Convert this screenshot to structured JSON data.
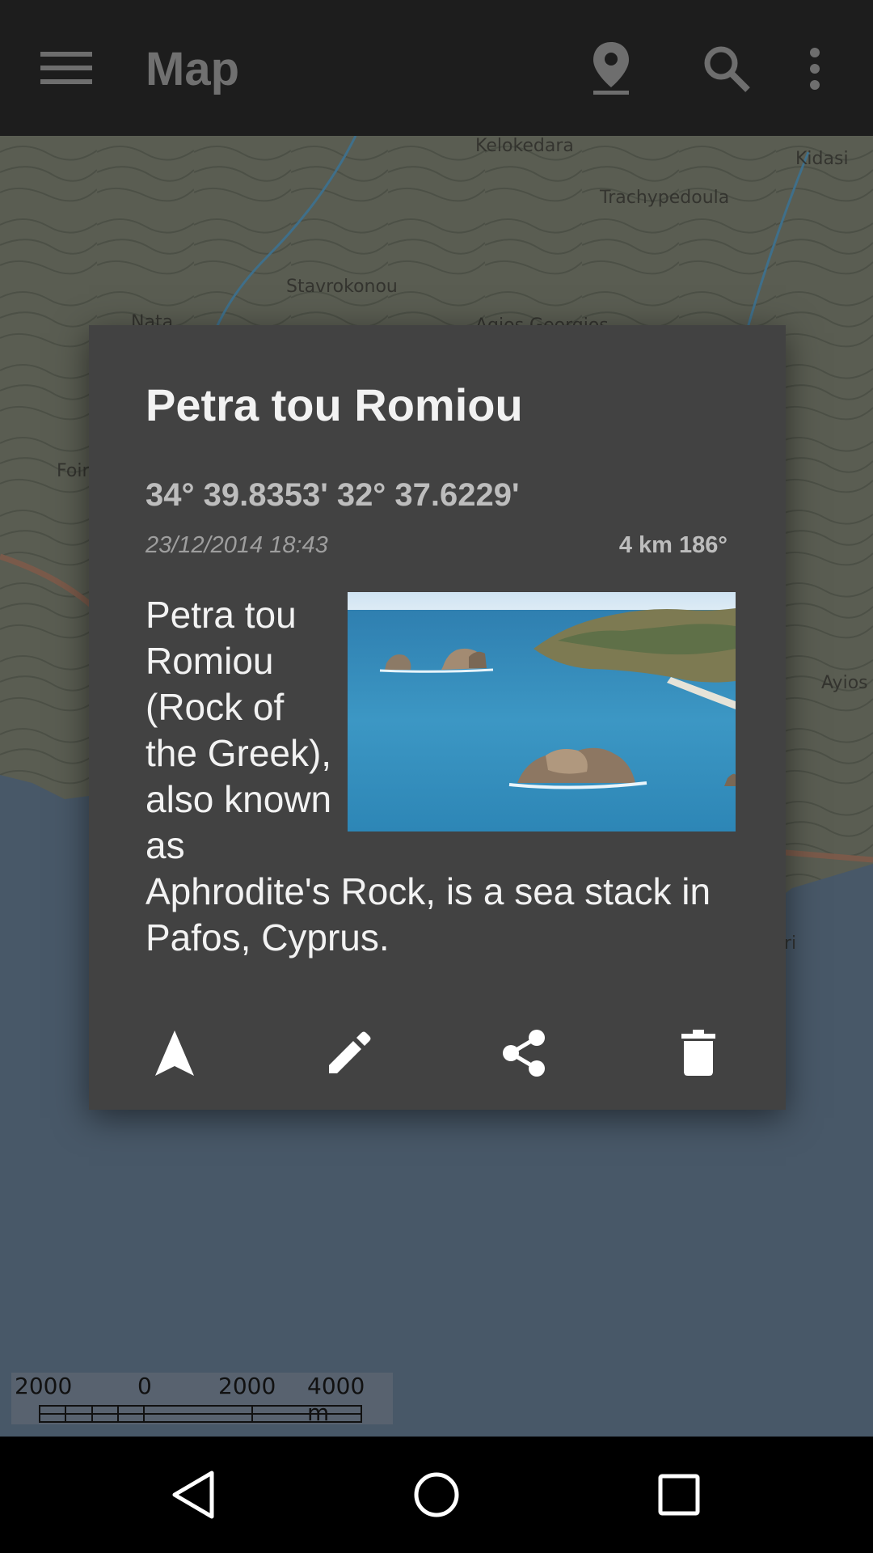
{
  "app_bar": {
    "title": "Map",
    "icons": [
      "menu-icon",
      "location-pin-icon",
      "search-icon",
      "more-vert-icon"
    ]
  },
  "map": {
    "labels": [
      {
        "text": "Kelokedara"
      },
      {
        "text": "Kidasi"
      },
      {
        "text": "Trachypedoula"
      },
      {
        "text": "Stavrokonou"
      },
      {
        "text": "Nata"
      },
      {
        "text": "Agios Georgios"
      },
      {
        "text": "Foini"
      },
      {
        "text": "Ayios T"
      },
      {
        "text": "ri"
      }
    ],
    "scale": {
      "ticks": [
        "2000",
        "0",
        "2000",
        "4000 m"
      ]
    }
  },
  "dialog": {
    "title": "Petra tou Romiou",
    "coordinates": "34° 39.8353' 32° 37.6229'",
    "date": "23/12/2014 18:43",
    "distance": "4 km 186°",
    "description": "Petra tou Romiou (Rock of the Greek), also known as Aphrodite's Rock, is a sea stack in Pafos, Cyprus.",
    "photo": "sea-stack-photo",
    "actions": [
      "navigate-icon",
      "edit-icon",
      "share-icon",
      "delete-icon"
    ]
  },
  "nav_bar": {
    "icons": [
      "back-icon",
      "home-icon",
      "recents-icon"
    ]
  }
}
